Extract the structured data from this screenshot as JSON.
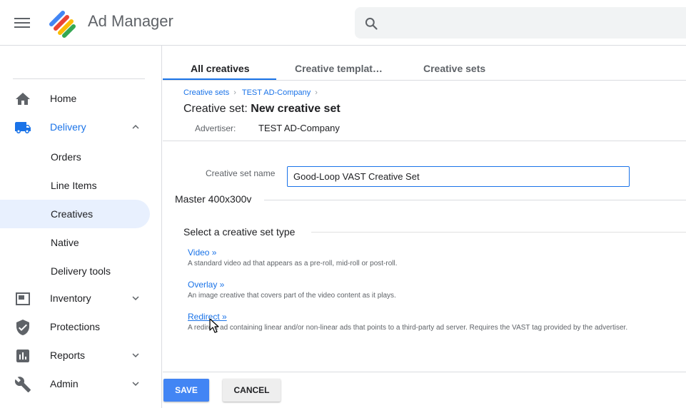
{
  "app": {
    "title": "Ad Manager"
  },
  "sidebar": {
    "items": [
      {
        "label": "Home",
        "icon": "home-icon"
      },
      {
        "label": "Delivery",
        "icon": "truck-icon",
        "expanded": true
      },
      {
        "label": "Orders"
      },
      {
        "label": "Line Items"
      },
      {
        "label": "Creatives",
        "active": true
      },
      {
        "label": "Native"
      },
      {
        "label": "Delivery tools"
      },
      {
        "label": "Inventory",
        "icon": "inventory-icon"
      },
      {
        "label": "Protections",
        "icon": "shield-icon"
      },
      {
        "label": "Reports",
        "icon": "bar-chart-icon"
      },
      {
        "label": "Admin",
        "icon": "wrench-icon"
      }
    ]
  },
  "tabs": [
    {
      "label": "All creatives",
      "active": true
    },
    {
      "label": "Creative templat…"
    },
    {
      "label": "Creative sets"
    }
  ],
  "breadcrumb": [
    "Creative sets",
    "TEST AD-Company"
  ],
  "page": {
    "title_prefix": "Creative set:",
    "title_name": "New creative set",
    "advertiser_label": "Advertiser:",
    "advertiser_value": "TEST AD-Company"
  },
  "form": {
    "name_label": "Creative set name",
    "name_value": "Good-Loop VAST Creative Set"
  },
  "master": {
    "title": "Master 400x300v"
  },
  "type_section": {
    "title": "Select a creative set type",
    "options": [
      {
        "label": "Video »",
        "description": "A standard video ad that appears as a pre-roll, mid-roll or post-roll."
      },
      {
        "label": "Overlay »",
        "description": "An image creative that covers part of the video content as it plays."
      },
      {
        "label": "Redirect »",
        "description": "A redirect ad containing linear and/or non-linear ads that points to a third-party ad server. Requires the VAST tag provided by the advertiser."
      }
    ]
  },
  "actions": {
    "save": "SAVE",
    "cancel": "CANCEL"
  },
  "colors": {
    "accent": "#1a73e8",
    "save_button": "#4285f4",
    "active_nav_bg": "#e8f0fe"
  }
}
